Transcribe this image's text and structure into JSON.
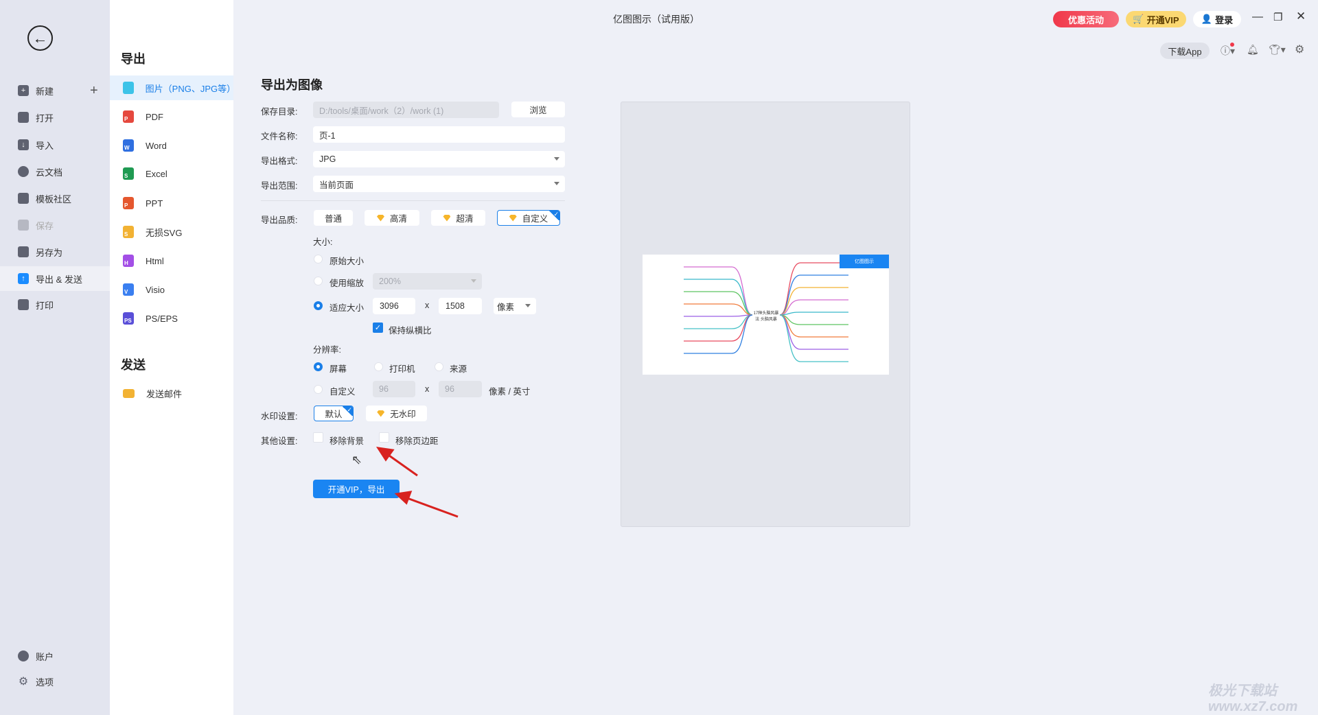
{
  "window": {
    "title": "亿图图示（试用版）"
  },
  "topbar": {
    "promo": "优惠活动",
    "vip": "开通VIP",
    "login": "登录",
    "download_app": "下载App"
  },
  "sidebar": {
    "items": [
      {
        "label": "新建",
        "icon": "plus-square-icon"
      },
      {
        "label": "打开",
        "icon": "folder-icon"
      },
      {
        "label": "导入",
        "icon": "import-icon"
      },
      {
        "label": "云文档",
        "icon": "cloud-icon"
      },
      {
        "label": "模板社区",
        "icon": "community-icon"
      },
      {
        "label": "保存",
        "icon": "save-icon"
      },
      {
        "label": "另存为",
        "icon": "save-as-icon"
      },
      {
        "label": "导出 & 发送",
        "icon": "export-icon"
      },
      {
        "label": "打印",
        "icon": "printer-icon"
      }
    ],
    "bottom": [
      {
        "label": "账户",
        "icon": "user-icon"
      },
      {
        "label": "选项",
        "icon": "gear-icon"
      }
    ]
  },
  "formats": {
    "export_heading": "导出",
    "send_heading": "发送",
    "items": [
      {
        "label": "图片（PNG、JPG等）",
        "color": "#3cc3e8",
        "letter": ""
      },
      {
        "label": "PDF",
        "color": "#e5483e",
        "letter": "P"
      },
      {
        "label": "Word",
        "color": "#2f6fe0",
        "letter": "W"
      },
      {
        "label": "Excel",
        "color": "#1f9a52",
        "letter": "S"
      },
      {
        "label": "PPT",
        "color": "#e5572e",
        "letter": "P"
      },
      {
        "label": "无损SVG",
        "color": "#f2b233",
        "letter": "S"
      },
      {
        "label": "Html",
        "color": "#a34fe6",
        "letter": "H"
      },
      {
        "label": "Visio",
        "color": "#3a7ff0",
        "letter": "V"
      },
      {
        "label": "PS/EPS",
        "color": "#5a4fd8",
        "letter": "PS"
      }
    ],
    "send_items": [
      {
        "label": "发送邮件",
        "color": "#f2b233"
      }
    ]
  },
  "panel": {
    "title": "导出为图像",
    "save_dir_label": "保存目录:",
    "save_dir": "D:/tools/桌面/work（2）/work (1)",
    "browse": "浏览",
    "filename_label": "文件名称:",
    "filename": "页-1",
    "format_label": "导出格式:",
    "format": "JPG",
    "range_label": "导出范围:",
    "range": "当前页面",
    "quality_label": "导出品质:",
    "quality": [
      "普通",
      "高清",
      "超清",
      "自定义"
    ],
    "size_label": "大小:",
    "original_size": "原始大小",
    "use_zoom": "使用缩放",
    "zoom_value": "200%",
    "fit_size": "适应大小",
    "width": "3096",
    "x": "x",
    "height": "1508",
    "unit": "像素",
    "keep_ratio": "保持纵横比",
    "resolution_label": "分辨率:",
    "res_screen": "屏幕",
    "res_printer": "打印机",
    "res_source": "来源",
    "res_custom": "自定义",
    "dpi_x": "96",
    "dpi_y": "96",
    "dpi_unit": "像素 / 英寸",
    "watermark_label": "水印设置:",
    "wm_default": "默认",
    "wm_none": "无水印",
    "other_label": "其他设置:",
    "remove_bg": "移除背景",
    "remove_margin": "移除页边距",
    "export_btn": "开通VIP，导出"
  },
  "preview": {
    "center": "17种头脑风暴法 头脑风暴",
    "badge": "亿图图示"
  },
  "watermark_logo": "极光下载站 www.xz7.com",
  "accent": "#1a7fe8"
}
